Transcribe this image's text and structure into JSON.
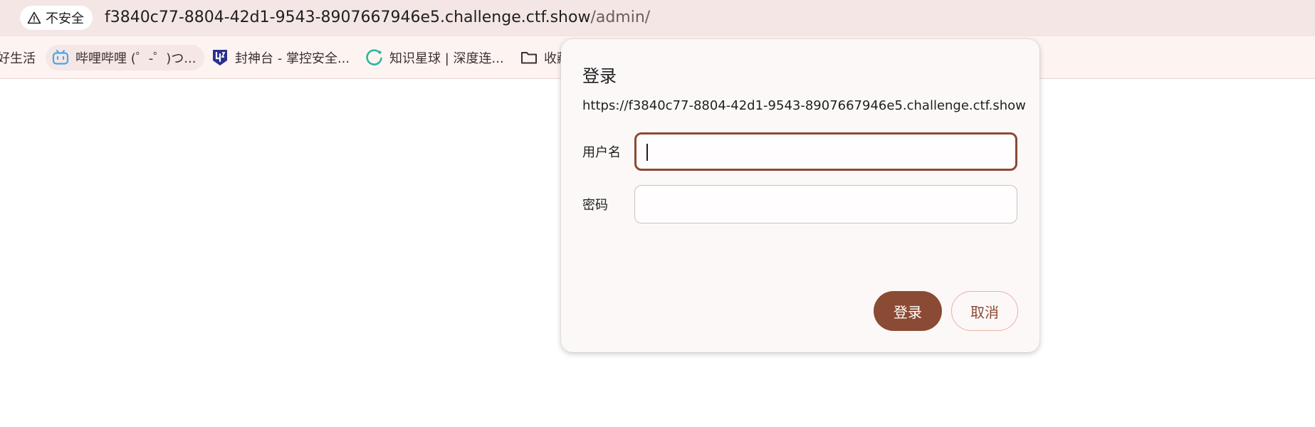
{
  "browser": {
    "security_label": "不安全",
    "url_host": "f3840c77-8804-42d1-9543-8907667946e5.challenge.ctf.show",
    "url_path": "/admin/",
    "bookmarks": [
      {
        "label": "好生活",
        "icon": "none"
      },
      {
        "label": "哔哩哔哩 (゜-゜)つ...",
        "icon": "bilibili-icon"
      },
      {
        "label": "封神台 - 掌控安全...",
        "icon": "fengshentai-icon"
      },
      {
        "label": "知识星球 | 深度连...",
        "icon": "zsxq-icon"
      },
      {
        "label": "收藏",
        "icon": "folder-icon"
      }
    ]
  },
  "dialog": {
    "title": "登录",
    "origin": "https://f3840c77-8804-42d1-9543-8907667946e5.challenge.ctf.show",
    "username_label": "用户名",
    "username_value": "",
    "password_label": "密码",
    "password_value": "",
    "login_button": "登录",
    "cancel_button": "取消"
  },
  "colors": {
    "accent": "#8b4a33",
    "address_bar_bg": "#f3e6e4",
    "dialog_bg": "#fdf8f8"
  }
}
